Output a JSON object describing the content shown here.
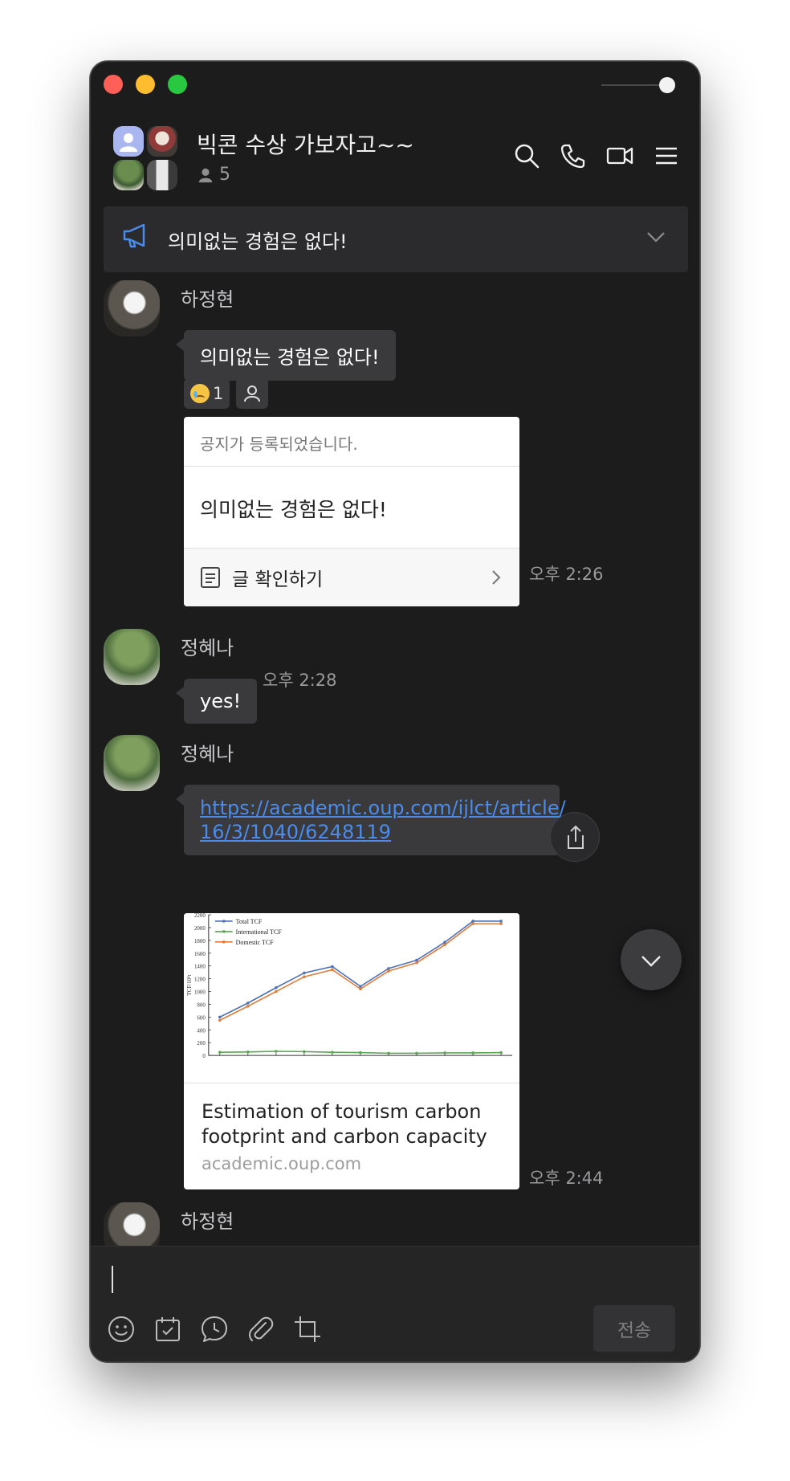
{
  "chat": {
    "title": "빅콘 수상 가보자고~~",
    "member_count": "5",
    "pinned_notice": "의미없는 경험은 없다!"
  },
  "messages": {
    "m1": {
      "sender": "하정현",
      "text": "의미없는 경험은 없다!",
      "reaction_count": "1"
    },
    "notice_card": {
      "header": "공지가 등록되었습니다.",
      "body": "의미없는 경험은 없다!",
      "action": "글 확인하기",
      "time": "오후 2:26"
    },
    "m2": {
      "sender": "정혜나",
      "text": "yes!",
      "time": "오후 2:28"
    },
    "m3": {
      "sender": "정혜나",
      "link_line1": "https://academic.oup.com/ijlct/article/",
      "link_line2": "16/3/1040/6248119",
      "preview_title_line1": "Estimation of tourism carbon",
      "preview_title_line2": "footprint and carbon capacity",
      "preview_domain": "academic.oup.com",
      "time": "오후 2:44"
    },
    "m4": {
      "sender": "하정현"
    }
  },
  "composer": {
    "send_label": "전송"
  },
  "icons": [
    "search-icon",
    "phone-icon",
    "video-icon",
    "menu-icon",
    "megaphone-icon",
    "chevron-down-icon",
    "person-icon",
    "document-icon",
    "chevron-right-icon",
    "share-icon",
    "emoji-icon",
    "calendar-check-icon",
    "chat-clock-icon",
    "paperclip-icon",
    "crop-icon"
  ],
  "preview_chart": {
    "legend": [
      "Total TCF",
      "International TCF",
      "Domestic TCF"
    ],
    "y_axis_label": "TCF/10⁴t",
    "y_ticks": [
      "2200",
      "2000",
      "1800",
      "1600",
      "1400",
      "1200",
      "1000",
      "800",
      "600",
      "400",
      "200",
      "0"
    ],
    "colors": {
      "total": "#4d72b8",
      "international": "#5aa651",
      "domestic": "#e07b39"
    }
  },
  "chart_data": {
    "type": "line",
    "x": [
      1,
      2,
      3,
      4,
      5,
      6,
      7,
      8,
      9,
      10,
      11
    ],
    "ylim": [
      0,
      2200
    ],
    "series": [
      {
        "name": "Total TCF",
        "values": [
          600,
          820,
          1060,
          1290,
          1390,
          1080,
          1360,
          1490,
          1770,
          2100,
          2100
        ]
      },
      {
        "name": "International TCF",
        "values": [
          50,
          55,
          65,
          60,
          50,
          45,
          35,
          35,
          40,
          40,
          45
        ]
      },
      {
        "name": "Domestic TCF",
        "values": [
          550,
          770,
          1000,
          1230,
          1340,
          1040,
          1320,
          1450,
          1730,
          2060,
          2060
        ]
      }
    ]
  }
}
